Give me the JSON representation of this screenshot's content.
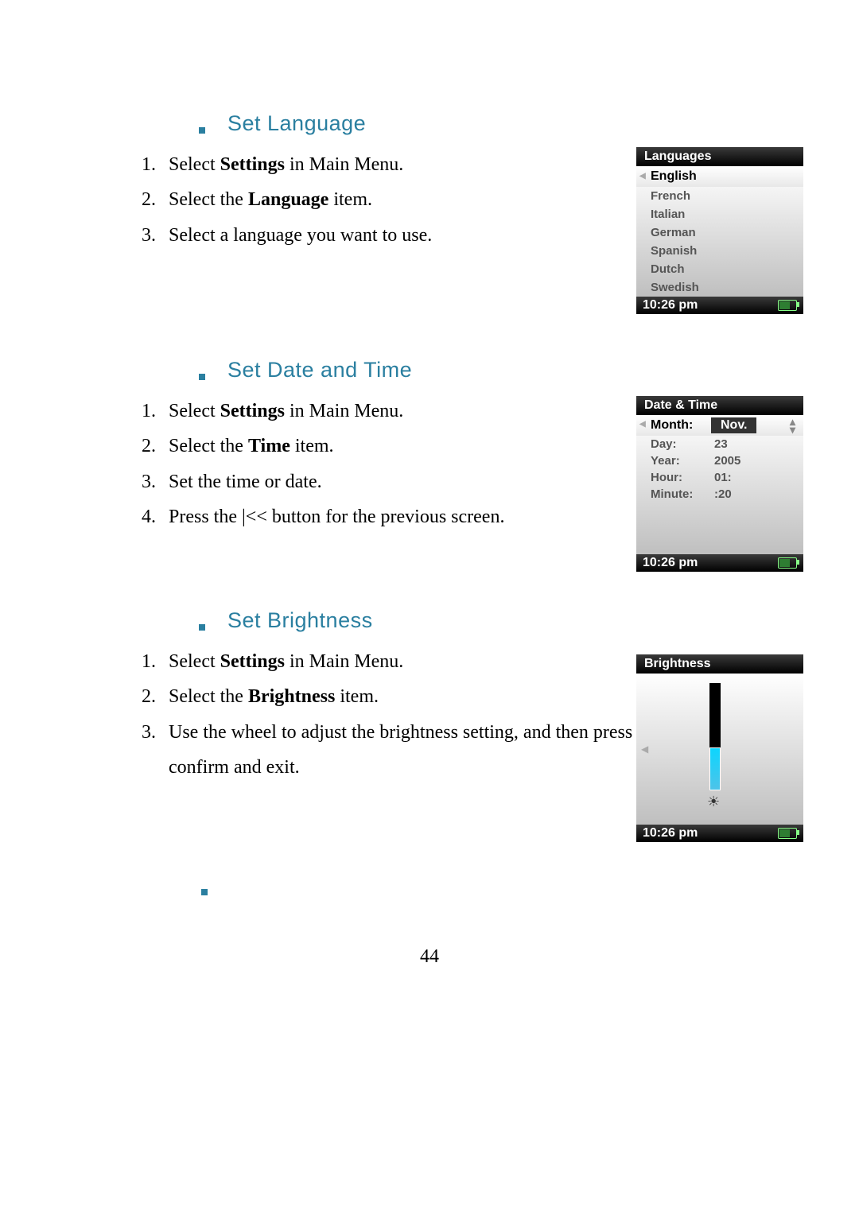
{
  "page_number": "44",
  "sections": {
    "language": {
      "title": "Set Language",
      "steps": [
        {
          "pre": "Select ",
          "b": "Settings",
          "post": " in Main Menu."
        },
        {
          "pre": "Select the ",
          "b": "Language",
          "post": " item."
        },
        {
          "pre": "Select a language you want to use.",
          "b": "",
          "post": ""
        }
      ]
    },
    "datetime": {
      "title": "Set Date and Time",
      "steps": [
        {
          "pre": "Select ",
          "b": "Settings",
          "post": " in Main Menu."
        },
        {
          "pre": "Select the ",
          "b": "Time",
          "post": " item."
        },
        {
          "pre": "Set the time or date.",
          "b": "",
          "post": ""
        },
        {
          "pre": "Press the |<< button for the previous screen.",
          "b": "",
          "post": ""
        }
      ]
    },
    "brightness": {
      "title": "Set Brightness",
      "steps": [
        {
          "pre": "Select ",
          "b": "Settings",
          "post": " in Main Menu."
        },
        {
          "pre": "Select the ",
          "b": "Brightness",
          "post": " item."
        },
        {
          "pre": "Use the wheel to adjust the brightness setting, and then press Select to confirm and exit.",
          "b": "",
          "post": ""
        }
      ]
    }
  },
  "device_lang": {
    "title": "Languages",
    "items": [
      "English",
      "French",
      "Italian",
      "German",
      "Spanish",
      "Dutch",
      "Swedish"
    ],
    "selected": 0,
    "time": "10:26 pm"
  },
  "device_dt": {
    "title": "Date & Time",
    "rows": [
      {
        "label": "Month:",
        "value": "Nov."
      },
      {
        "label": "Day:",
        "value": "23"
      },
      {
        "label": "Year:",
        "value": "2005"
      },
      {
        "label": "Hour:",
        "value": "01:"
      },
      {
        "label": "Minute:",
        "value": ":20"
      }
    ],
    "selected": 0,
    "time": "10:26 pm"
  },
  "device_br": {
    "title": "Brightness",
    "time": "10:26 pm"
  }
}
